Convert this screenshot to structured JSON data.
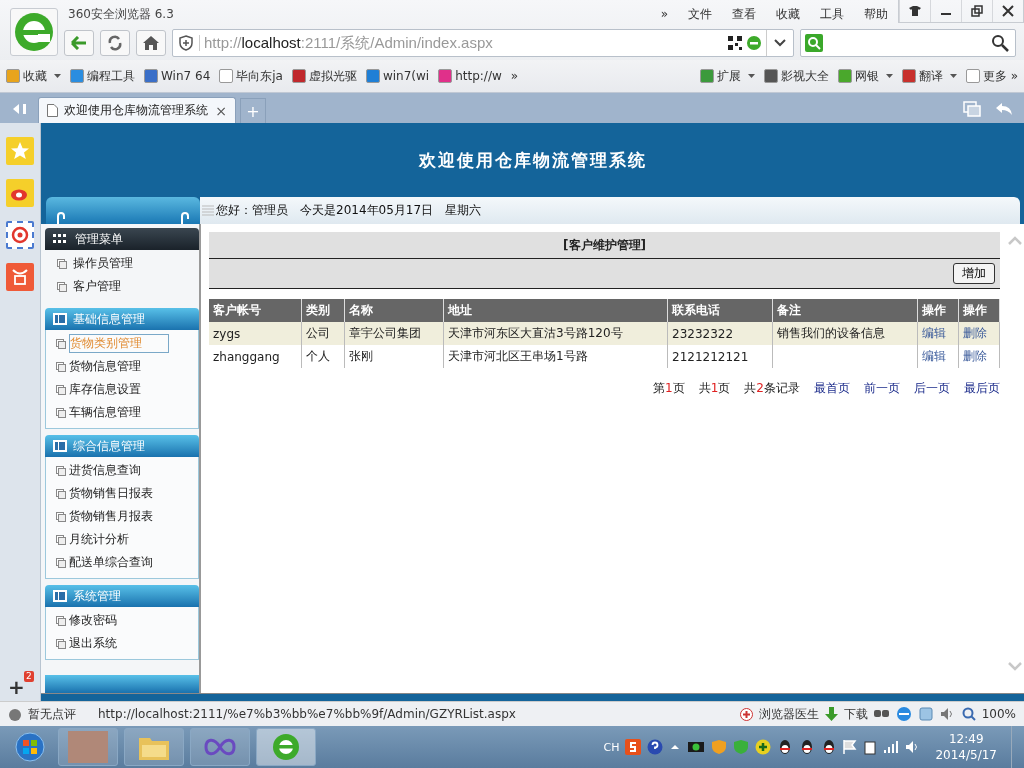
{
  "browser": {
    "title": "360安全浏览器 6.3",
    "menu": [
      "»",
      "文件",
      "查看",
      "收藏",
      "工具",
      "帮助"
    ],
    "address": {
      "prefix": "http://",
      "host": "localhost",
      "rest": ":2111/系统/Admin/index.aspx"
    }
  },
  "bookmarks": [
    {
      "label": "收藏",
      "dropdown": true,
      "color": "#e8a41c"
    },
    {
      "label": "编程工具",
      "dropdown": false,
      "color": "#2a8de0"
    },
    {
      "label": "Win7 64",
      "dropdown": false,
      "color": "#3a6fc8"
    },
    {
      "label": "毕向东ja",
      "dropdown": false,
      "color": "#ffffff"
    },
    {
      "label": "虚拟光驱",
      "dropdown": false,
      "color": "#c0282c"
    },
    {
      "label": "win7(wi",
      "dropdown": false,
      "color": "#1f7fd6"
    },
    {
      "label": "http://w",
      "dropdown": false,
      "color": "#e0308a"
    }
  ],
  "bookmarks_more": "»",
  "tools": [
    {
      "label": "扩展",
      "dropdown": true,
      "color": "#3c9a3c"
    },
    {
      "label": "影视大全",
      "dropdown": false,
      "color": "#555555"
    },
    {
      "label": "网银",
      "dropdown": true,
      "color": "#4aa82c"
    },
    {
      "label": "翻译",
      "dropdown": true,
      "color": "#c8302c"
    },
    {
      "label": "更多 »",
      "dropdown": false,
      "color": "#ffffff"
    }
  ],
  "tabs": [
    {
      "label": "欢迎使用仓库物流管理系统",
      "selected": true,
      "close": "×"
    }
  ],
  "new_tab": "+",
  "side_strip": {
    "add": "+",
    "badge": "2"
  },
  "page": {
    "title": "欢迎使用仓库物流管理系统",
    "greeting": "您好：管理员　今天是2014年05月17日　星期六"
  },
  "menu": [
    {
      "title": "管理菜单",
      "kind": "dark",
      "items": [
        {
          "label": "操作员管理",
          "selected": false
        },
        {
          "label": "客户管理",
          "selected": false
        }
      ]
    },
    {
      "title": "基础信息管理",
      "kind": "blue",
      "items": [
        {
          "label": "货物类别管理",
          "selected": true
        },
        {
          "label": "货物信息管理",
          "selected": false
        },
        {
          "label": "库存信息设置",
          "selected": false
        },
        {
          "label": "车辆信息管理",
          "selected": false
        }
      ]
    },
    {
      "title": "综合信息管理",
      "kind": "blue",
      "items": [
        {
          "label": "进货信息查询",
          "selected": false
        },
        {
          "label": "货物销售日报表",
          "selected": false
        },
        {
          "label": "货物销售月报表",
          "selected": false
        },
        {
          "label": "月统计分析",
          "selected": false
        },
        {
          "label": "配送单综合查询",
          "selected": false
        }
      ]
    },
    {
      "title": "系统管理",
      "kind": "blue",
      "items": [
        {
          "label": "修改密码",
          "selected": false
        },
        {
          "label": "退出系统",
          "selected": false
        }
      ]
    }
  ],
  "panel": {
    "title": "[客户维护管理]",
    "add_button": "增加"
  },
  "table": {
    "columns": [
      "客户帐号",
      "类别",
      "名称",
      "地址",
      "联系电话",
      "备注",
      "操作",
      "操作"
    ],
    "rows": [
      {
        "selected": true,
        "cells": [
          "zygs",
          "公司",
          "章宇公司集团",
          "天津市河东区大直沽3号路120号",
          "23232322",
          "销售我们的设备信息"
        ],
        "edit": "编辑",
        "delete": "删除"
      },
      {
        "selected": false,
        "cells": [
          "zhanggang",
          "个人",
          "张刚",
          "天津市河北区王串场1号路",
          "2121212121",
          ""
        ],
        "edit": "编辑",
        "delete": "删除"
      }
    ]
  },
  "pagination": {
    "info": [
      {
        "pre": "第",
        "num": "1",
        "post": "页"
      },
      {
        "pre": "共",
        "num": "1",
        "post": "页"
      },
      {
        "pre": "共",
        "num": "2",
        "post": "条记录"
      }
    ],
    "links": [
      "最首页",
      "前一页",
      "后一页",
      "最后页"
    ]
  },
  "status_bar": {
    "rating": "暂无点评",
    "url": "http://localhost:2111/%e7%b3%bb%e7%bb%9f/Admin/GZYRList.aspx",
    "doctor": "浏览器医生",
    "download": "下载",
    "zoom": "100%"
  },
  "taskbar": {
    "apps": [
      {
        "kind": "photo",
        "selected": false
      },
      {
        "kind": "folder",
        "selected": false
      },
      {
        "kind": "infinity",
        "selected": false
      },
      {
        "kind": "browser",
        "selected": true
      }
    ],
    "lang": "CH",
    "time": "12:49",
    "date": "2014/5/17"
  }
}
